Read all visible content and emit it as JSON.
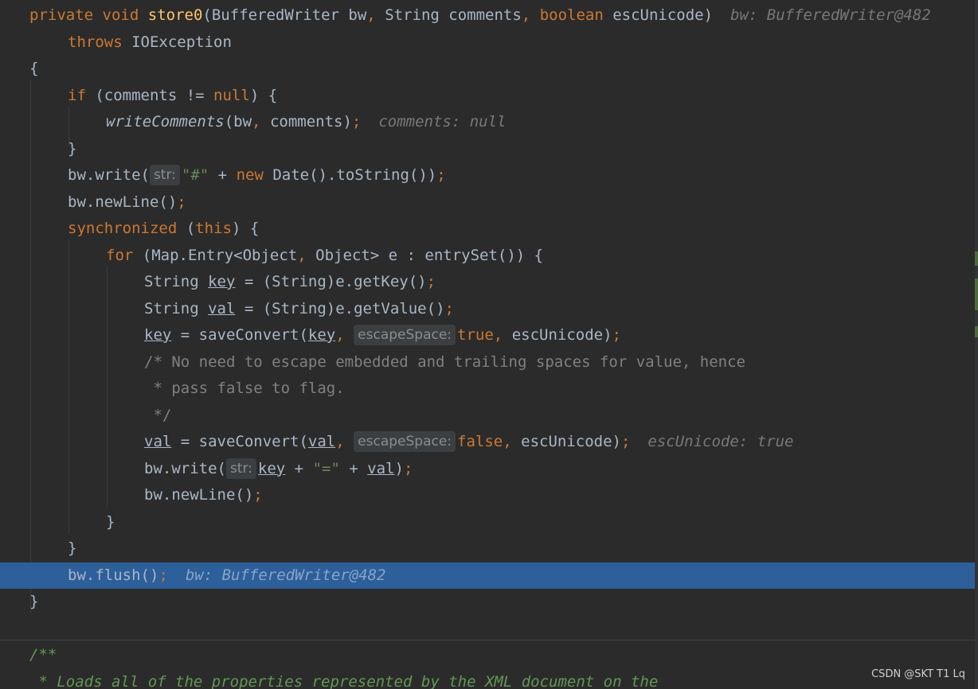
{
  "editor": {
    "lines": {
      "l1": {
        "kw_private": "private",
        "kw_void": "void",
        "method_name": "store0",
        "params_a": "(BufferedWriter bw",
        "comma1": ",",
        "params_b": " String comments",
        "comma2": ",",
        "kw_boolean": "boolean",
        "params_c": " escUnicode)",
        "inlay": "bw: BufferedWriter@482"
      },
      "l2": {
        "kw_throws": "throws",
        "exception": " IOException"
      },
      "l3": {
        "text": "{"
      },
      "l4": {
        "kw_if": "if",
        "a": " (comments != ",
        "kw_null": "null",
        "b": ") {"
      },
      "l5": {
        "call": "writeComments",
        "args": "(bw",
        "comma": ",",
        "args2": " comments)",
        "semi": ";",
        "inlay": "comments: null"
      },
      "l6": {
        "text": "}"
      },
      "l7": {
        "a": "bw.write(",
        "hint": "str:",
        "str": "\"#\"",
        "b": " + ",
        "kw_new": "new",
        "c": " Date().toString())",
        "semi": ";"
      },
      "l8": {
        "a": "bw.newLine()",
        "semi": ";"
      },
      "l9": {
        "kw_sync": "synchronized",
        "a": " (",
        "kw_this": "this",
        "b": ") {"
      },
      "l10": {
        "kw_for": "for",
        "a": " (Map.Entry<Object",
        "comma": ",",
        "b": " Object> e : entrySet()) {"
      },
      "l11": {
        "a": "String ",
        "var": "key",
        "b": " = (String)e.getKey()",
        "semi": ";"
      },
      "l12": {
        "a": "String ",
        "var": "val",
        "b": " = (String)e.getValue()",
        "semi": ";"
      },
      "l13": {
        "var1": "key",
        "a": " = saveConvert(",
        "var2": "key",
        "comma": ",",
        "hint": "escapeSpace:",
        "kw_true": "true",
        "comma2": ",",
        "b": " escUnicode)",
        "semi": ";"
      },
      "l14": {
        "text": "/* No need to escape embedded and trailing spaces for value, hence"
      },
      "l15": {
        "text": " * pass false to flag."
      },
      "l16": {
        "text": " */"
      },
      "l17": {
        "var1": "val",
        "a": " = saveConvert(",
        "var2": "val",
        "comma": ",",
        "hint": "escapeSpace:",
        "kw_false": "false",
        "comma2": ",",
        "b": " escUnicode)",
        "semi": ";",
        "inlay": "escUnicode: true"
      },
      "l18": {
        "a": "bw.write(",
        "hint": "str:",
        "var1": "key",
        "b": " + ",
        "str": "\"=\"",
        "c": " + ",
        "var2": "val",
        "d": ")",
        "semi": ";"
      },
      "l19": {
        "a": "bw.newLine()",
        "semi": ";"
      },
      "l20": {
        "text": "}"
      },
      "l21": {
        "text": "}"
      },
      "l22": {
        "a": "bw.flush()",
        "semi": ";",
        "inlay": "bw: BufferedWriter@482"
      },
      "l23": {
        "text": "}"
      },
      "l24": {
        "text": "/**"
      },
      "l25": {
        "text": " * Loads all of the properties represented by the XML document on the"
      }
    }
  },
  "watermark": "CSDN @SKT T1 Lq",
  "colors": {
    "background": "#2b2b2b",
    "keyword": "#cc7832",
    "method": "#ffc66d",
    "string": "#6a8759",
    "comment": "#808080",
    "doc_comment": "#629755",
    "current_line": "#2d5f9a"
  }
}
